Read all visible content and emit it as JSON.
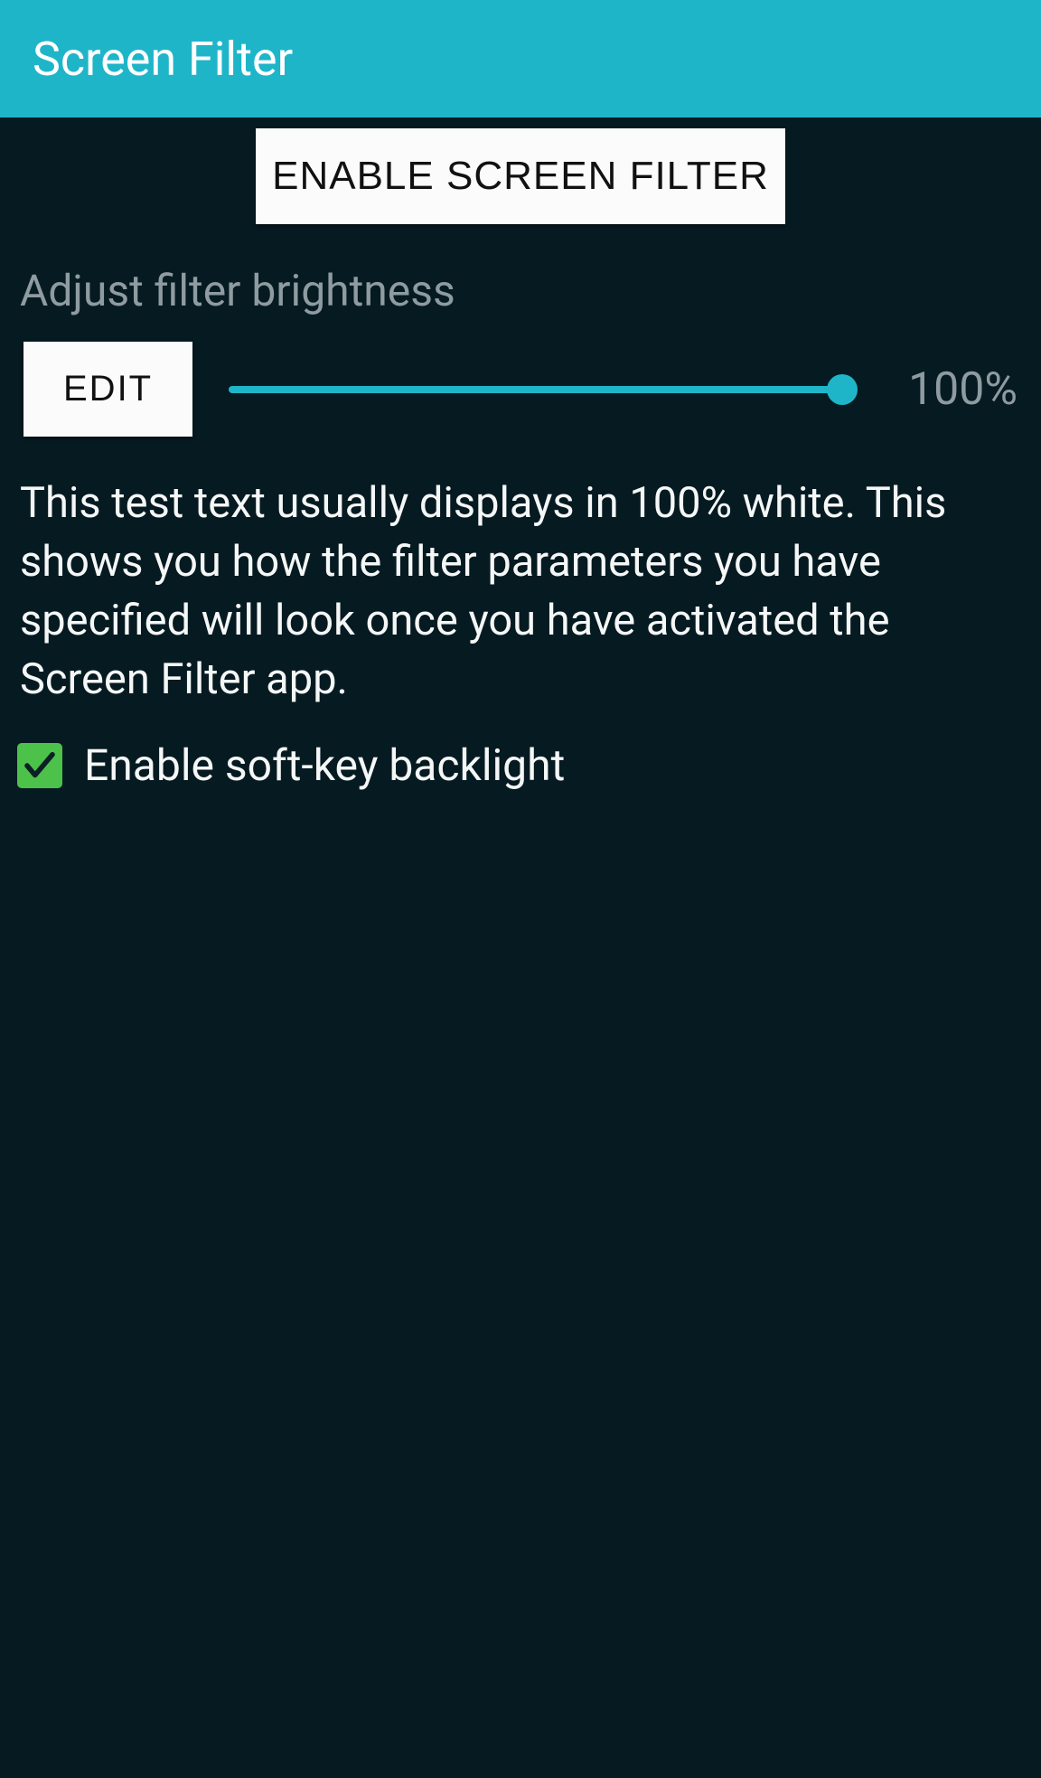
{
  "header": {
    "title": "Screen Filter"
  },
  "main": {
    "enable_button_label": "ENABLE SCREEN FILTER",
    "brightness_section_label": "Adjust filter brightness",
    "edit_button_label": "EDIT",
    "brightness_percent": "100%",
    "slider_value": 100,
    "description": "This test text usually displays in 100% white. This shows you how the filter parameters you have specified will look once you have activated the Screen Filter app.",
    "checkbox_label": "Enable soft-key backlight",
    "checkbox_checked": true
  },
  "colors": {
    "accent": "#1fb5c9",
    "background": "#061a21",
    "checkbox": "#4cc24a"
  }
}
